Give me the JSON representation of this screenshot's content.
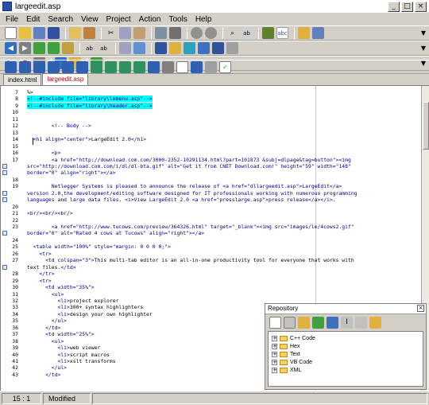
{
  "window": {
    "title": "largeedit.asp"
  },
  "menu": [
    "File",
    "Edit",
    "Search",
    "View",
    "Project",
    "Action",
    "Tools",
    "Help"
  ],
  "tabs": [
    "index.html",
    "largeedit.asp"
  ],
  "active_tab": 1,
  "editor": {
    "lines": [
      {
        "n": "7",
        "parts": [
          [
            "%>",
            ""
          ]
        ]
      },
      {
        "n": "8",
        "parts": [
          [
            "<!--#include file=\"library\\lemenu.asp\"-->",
            "hl-cyan c-navy"
          ]
        ]
      },
      {
        "n": "9",
        "parts": [
          [
            "<!--#include file=\"library\\header.asp\"-->",
            "hl-cyan c-navy"
          ]
        ]
      },
      {
        "n": "10",
        "parts": []
      },
      {
        "n": "11",
        "parts": []
      },
      {
        "n": "12",
        "parts": [
          [
            "        <!-- Body -->",
            "c-navy"
          ]
        ]
      },
      {
        "n": "13",
        "parts": []
      },
      {
        "n": "14",
        "parts": [
          [
            "  <h1 align=\"center\">",
            "c-navy"
          ],
          [
            "LargeEdit 2.0",
            ""
          ],
          [
            "</h1>",
            "c-navy"
          ]
        ]
      },
      {
        "n": "15",
        "parts": []
      },
      {
        "n": "16",
        "parts": [
          [
            "        <p>",
            "c-navy"
          ]
        ]
      },
      {
        "n": "17",
        "wrap": true,
        "parts": [
          [
            "        <a href=\"http://download.com.com/3000-2352-10291134.html?part=101873 &subj=dlpage&tag=button\"><img",
            "c-navy"
          ]
        ]
      },
      {
        "n": "",
        "parts": [
          [
            "src=\"http://download.com.com/i/dl/dl-bta.gif\" alt=\"Get it from CNET Download.com!\" height=\"59\" width=\"148\"",
            "c-navy"
          ]
        ]
      },
      {
        "n": "",
        "parts": [
          [
            "border=\"0\" align=\"right\"></a>",
            "c-navy"
          ]
        ]
      },
      {
        "n": "18",
        "parts": []
      },
      {
        "n": "19",
        "wrap": true,
        "parts": [
          [
            "        Netlegger Systems is pleased to announce the release of <a href=\"dllargeedit.asp\">LargeEdit</a>",
            "c-navy"
          ]
        ]
      },
      {
        "n": "",
        "parts": [
          [
            "version 2.0,the development/editing software designed for IT professionals working with numerous programming",
            "c-navy"
          ]
        ]
      },
      {
        "n": "",
        "parts": [
          [
            "languages and large data files. <i>View LargeEdit 2.0 <a href=\"presslarge.asp\">press release</a></i>.",
            "c-navy"
          ]
        ]
      },
      {
        "n": "20",
        "parts": []
      },
      {
        "n": "21",
        "parts": [
          [
            "<br/><br/><br/>",
            "c-navy"
          ]
        ]
      },
      {
        "n": "22",
        "parts": []
      },
      {
        "n": "23",
        "wrap": true,
        "parts": [
          [
            "        <a href=\"http://www.tucows.com/preview/364326.html\" target=\"_blank\"><img src=\"images/le/4cows2.gif\"",
            "c-navy"
          ]
        ]
      },
      {
        "n": "",
        "parts": [
          [
            "border=\"0\" alt=\"Rated 4 cows at Tucows\" align=\"right\"></a>",
            "c-navy"
          ]
        ]
      },
      {
        "n": "24",
        "parts": []
      },
      {
        "n": "25",
        "parts": [
          [
            "  <table width=\"100%\" style=\"margin: 0 0 0 0;\">",
            "c-navy"
          ]
        ]
      },
      {
        "n": "26",
        "parts": [
          [
            "    <tr>",
            "c-navy"
          ]
        ]
      },
      {
        "n": "27",
        "wrap": true,
        "parts": [
          [
            "      <td colspan=\"3\">",
            "c-navy"
          ],
          [
            "This multi-tab editor is an all-in-one productivity tool for everyone that works with",
            ""
          ]
        ]
      },
      {
        "n": "",
        "parts": [
          [
            "text files.",
            ""
          ],
          [
            "</td>",
            "c-navy"
          ]
        ]
      },
      {
        "n": "28",
        "parts": [
          [
            "    </tr>",
            "c-navy"
          ]
        ]
      },
      {
        "n": "29",
        "parts": [
          [
            "    <tr>",
            "c-navy"
          ]
        ]
      },
      {
        "n": "30",
        "parts": [
          [
            "      <td width=\"35%\">",
            "c-navy"
          ]
        ]
      },
      {
        "n": "31",
        "parts": [
          [
            "        <ul>",
            "c-navy"
          ]
        ]
      },
      {
        "n": "32",
        "parts": [
          [
            "          <li>",
            "c-navy"
          ],
          [
            "project explorer",
            ""
          ]
        ]
      },
      {
        "n": "33",
        "parts": [
          [
            "          <li>",
            "c-navy"
          ],
          [
            "300+ syntax highlighters",
            ""
          ]
        ]
      },
      {
        "n": "34",
        "parts": [
          [
            "          <li>",
            "c-navy"
          ],
          [
            "design your own highlighter",
            ""
          ]
        ]
      },
      {
        "n": "35",
        "parts": [
          [
            "        </ul>",
            "c-navy"
          ]
        ]
      },
      {
        "n": "36",
        "parts": [
          [
            "      </td>",
            "c-navy"
          ]
        ]
      },
      {
        "n": "37",
        "parts": [
          [
            "      <td width=\"25%\">",
            "c-navy"
          ]
        ]
      },
      {
        "n": "38",
        "parts": [
          [
            "        <ul>",
            "c-navy"
          ]
        ]
      },
      {
        "n": "39",
        "parts": [
          [
            "          <li>",
            "c-navy"
          ],
          [
            "web viewer",
            ""
          ]
        ]
      },
      {
        "n": "40",
        "parts": [
          [
            "          <li>",
            "c-navy"
          ],
          [
            "script macros",
            ""
          ]
        ]
      },
      {
        "n": "41",
        "parts": [
          [
            "          <li>",
            "c-navy"
          ],
          [
            "xslt transforms",
            ""
          ]
        ]
      },
      {
        "n": "42",
        "parts": [
          [
            "        </ul>",
            "c-navy"
          ]
        ]
      },
      {
        "n": "43",
        "parts": [
          [
            "      </td>",
            "c-navy"
          ]
        ]
      }
    ]
  },
  "repository": {
    "title": "Repository",
    "items": [
      "C++ Code",
      "Hex",
      "Text",
      "VB Code",
      "XML"
    ]
  },
  "status": {
    "position": "15 : 1",
    "state": "Modified"
  }
}
